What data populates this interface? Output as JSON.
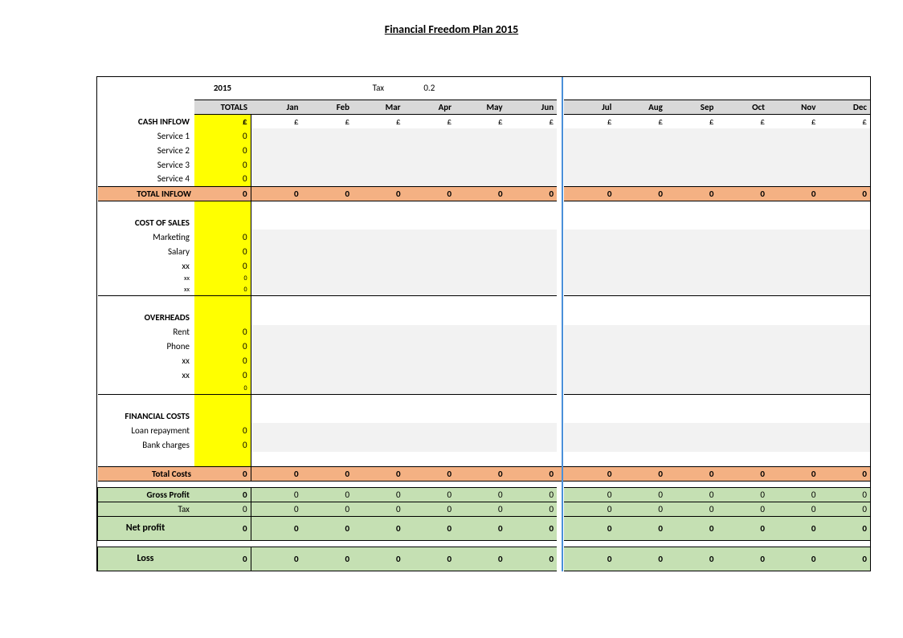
{
  "title": "Financial Freedom Plan 2015",
  "year": "2015",
  "taxLabel": "Tax",
  "taxRate": "0.2",
  "headers": {
    "totals": "TOTALS",
    "months": [
      "Jan",
      "Feb",
      "Mar",
      "Apr",
      "May",
      "Jun",
      "Jul",
      "Aug",
      "Sep",
      "Oct",
      "Nov",
      "Dec"
    ]
  },
  "currency": "£",
  "sections": {
    "cashInflow": {
      "title": "CASH INFLOW",
      "rows": [
        {
          "label": "Service 1",
          "total": "0"
        },
        {
          "label": "Service 2",
          "total": "0"
        },
        {
          "label": "Service 3",
          "total": "0"
        },
        {
          "label": "Service 4",
          "total": "0"
        }
      ],
      "totalRow": {
        "label": "TOTAL INFLOW",
        "total": "0",
        "months": [
          "0",
          "0",
          "0",
          "0",
          "0",
          "0",
          "0",
          "0",
          "0",
          "0",
          "0",
          "0"
        ]
      }
    },
    "costOfSales": {
      "title": "COST OF SALES",
      "rows": [
        {
          "label": "Marketing",
          "total": "0"
        },
        {
          "label": "Salary",
          "total": "0"
        },
        {
          "label": "xx",
          "total": "0"
        },
        {
          "label": "xx",
          "total": "0"
        },
        {
          "label": "xx",
          "total": "0"
        }
      ]
    },
    "overheads": {
      "title": "OVERHEADS",
      "rows": [
        {
          "label": "Rent",
          "total": "0"
        },
        {
          "label": "Phone",
          "total": "0"
        },
        {
          "label": "xx",
          "total": "0"
        },
        {
          "label": "xx",
          "total": "0"
        }
      ],
      "extra": "0"
    },
    "financialCosts": {
      "title": "FINANCIAL COSTS",
      "rows": [
        {
          "label": "Loan repayment",
          "total": "0"
        },
        {
          "label": "Bank charges",
          "total": "0"
        }
      ]
    },
    "totalCosts": {
      "label": "Total Costs",
      "total": "0",
      "months": [
        "0",
        "0",
        "0",
        "0",
        "0",
        "0",
        "0",
        "0",
        "0",
        "0",
        "0",
        "0"
      ]
    },
    "grossProfit": {
      "label": "Gross Profit",
      "total": "0",
      "months": [
        "0",
        "0",
        "0",
        "0",
        "0",
        "0",
        "0",
        "0",
        "0",
        "0",
        "0",
        "0"
      ]
    },
    "tax": {
      "label": "Tax",
      "total": "0",
      "months": [
        "0",
        "0",
        "0",
        "0",
        "0",
        "0",
        "0",
        "0",
        "0",
        "0",
        "0",
        "0"
      ]
    },
    "netProfit": {
      "label": "Net profit",
      "total": "0",
      "months": [
        "0",
        "0",
        "0",
        "0",
        "0",
        "0",
        "0",
        "0",
        "0",
        "0",
        "0",
        "0"
      ]
    },
    "loss": {
      "label": "Loss",
      "total": "0",
      "months": [
        "0",
        "0",
        "0",
        "0",
        "0",
        "0",
        "0",
        "0",
        "0",
        "0",
        "0",
        "0"
      ]
    }
  }
}
